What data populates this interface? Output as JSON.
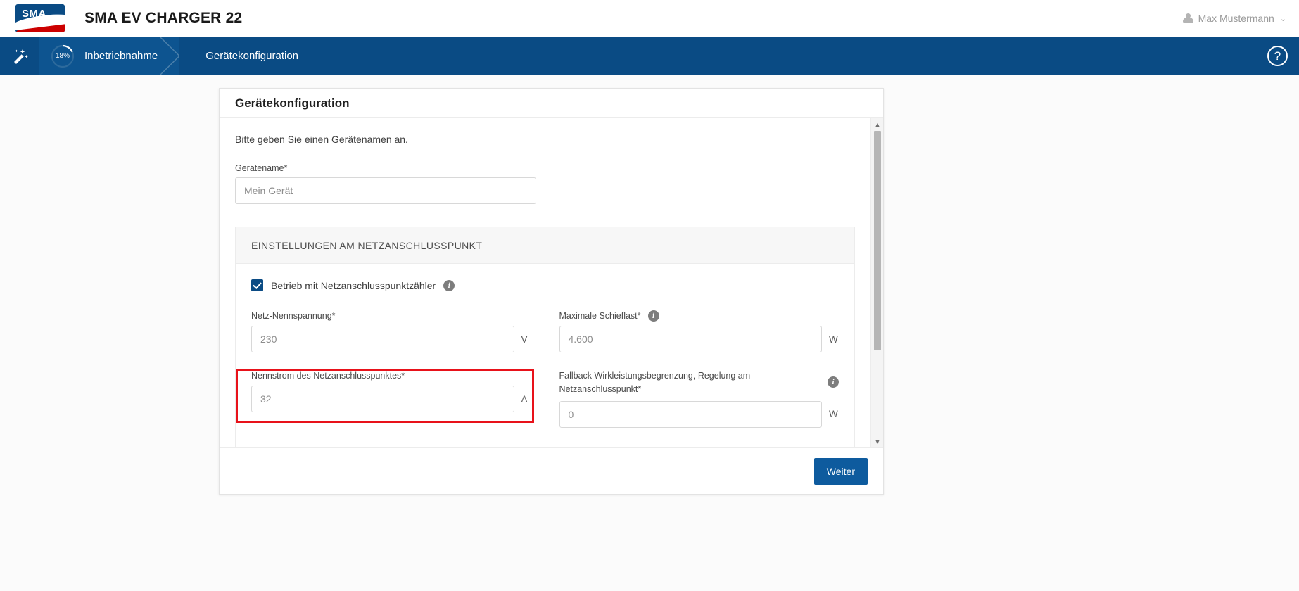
{
  "header": {
    "logo_text": "SMA",
    "app_title": "SMA EV CHARGER 22",
    "user_name": "Max Mustermann",
    "user_chevron": "⌄"
  },
  "nav": {
    "wand_icon": "magic-wand-icon",
    "progress_percent": "18%",
    "progress_value": 18,
    "step1": "Inbetriebnahme",
    "step2": "Gerätekonfiguration",
    "help_label": "?"
  },
  "card": {
    "title": "Gerätekonfiguration",
    "intro": "Bitte geben Sie einen Gerätenamen an.",
    "device_name": {
      "label": "Gerätename*",
      "placeholder": "Mein Gerät",
      "value": ""
    },
    "section": {
      "heading": "EINSTELLUNGEN AM NETZANSCHLUSSPUNKT",
      "checkbox": {
        "label": "Betrieb mit Netzanschlusspunktzähler",
        "checked": true,
        "info": "i"
      },
      "fields": [
        {
          "label": "Netz-Nennspannung*",
          "value": "230",
          "unit": "V",
          "info": false
        },
        {
          "label": "Maximale Schieflast*",
          "value": "4.600",
          "unit": "W",
          "info": true,
          "info_glyph": "i"
        },
        {
          "label": "Nennstrom des Netzanschlusspunktes*",
          "value": "32",
          "unit": "A",
          "info": false,
          "highlighted": true
        },
        {
          "label": "Fallback Wirkleistungsbegrenzung, Regelung am Netzanschlusspunkt*",
          "value": "0",
          "unit": "W",
          "info": true,
          "info_glyph": "i"
        }
      ]
    }
  },
  "footer": {
    "next_label": "Weiter"
  },
  "scrollbar": {
    "up_arrow": "▲",
    "down_arrow": "▼"
  },
  "colors": {
    "brand_blue": "#0a4b84",
    "brand_red": "#cc0000",
    "highlight_red": "#e8121a",
    "button_blue": "#0e5b9e"
  }
}
